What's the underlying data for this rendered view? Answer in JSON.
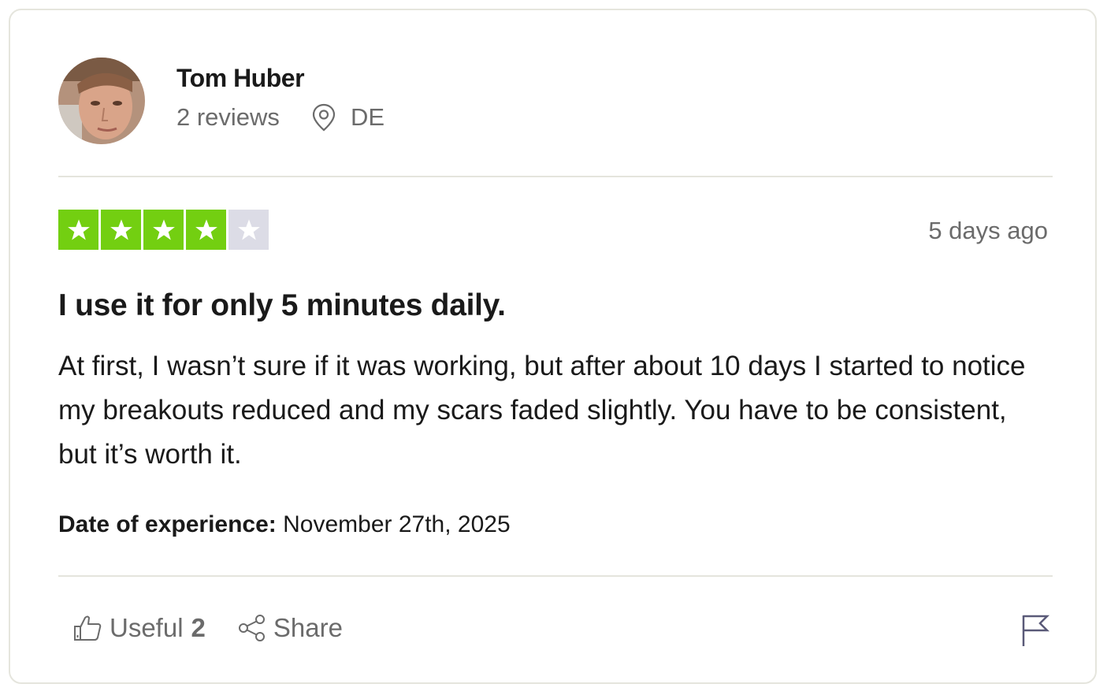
{
  "reviewer": {
    "name": "Tom Huber",
    "reviews_count": "2 reviews",
    "country": "DE"
  },
  "rating": {
    "stars_filled": 4,
    "stars_total": 5,
    "star_color": "#73cf11",
    "star_empty_color": "#dcdce6"
  },
  "review": {
    "date_ago": "5 days ago",
    "title": "I use it for only 5 minutes daily.",
    "body": "At first, I wasn’t sure if it was working, but after about 10 days I started to notice my breakouts reduced and my scars faded slightly. You have to be consistent, but it’s worth it.",
    "experience_label": "Date of experience:",
    "experience_date": "November 27th, 2025"
  },
  "actions": {
    "useful_label": "Useful",
    "useful_count": "2",
    "share_label": "Share",
    "icons": [
      "thumbs-up-icon",
      "share-icon",
      "flag-icon",
      "location-pin-icon"
    ]
  }
}
